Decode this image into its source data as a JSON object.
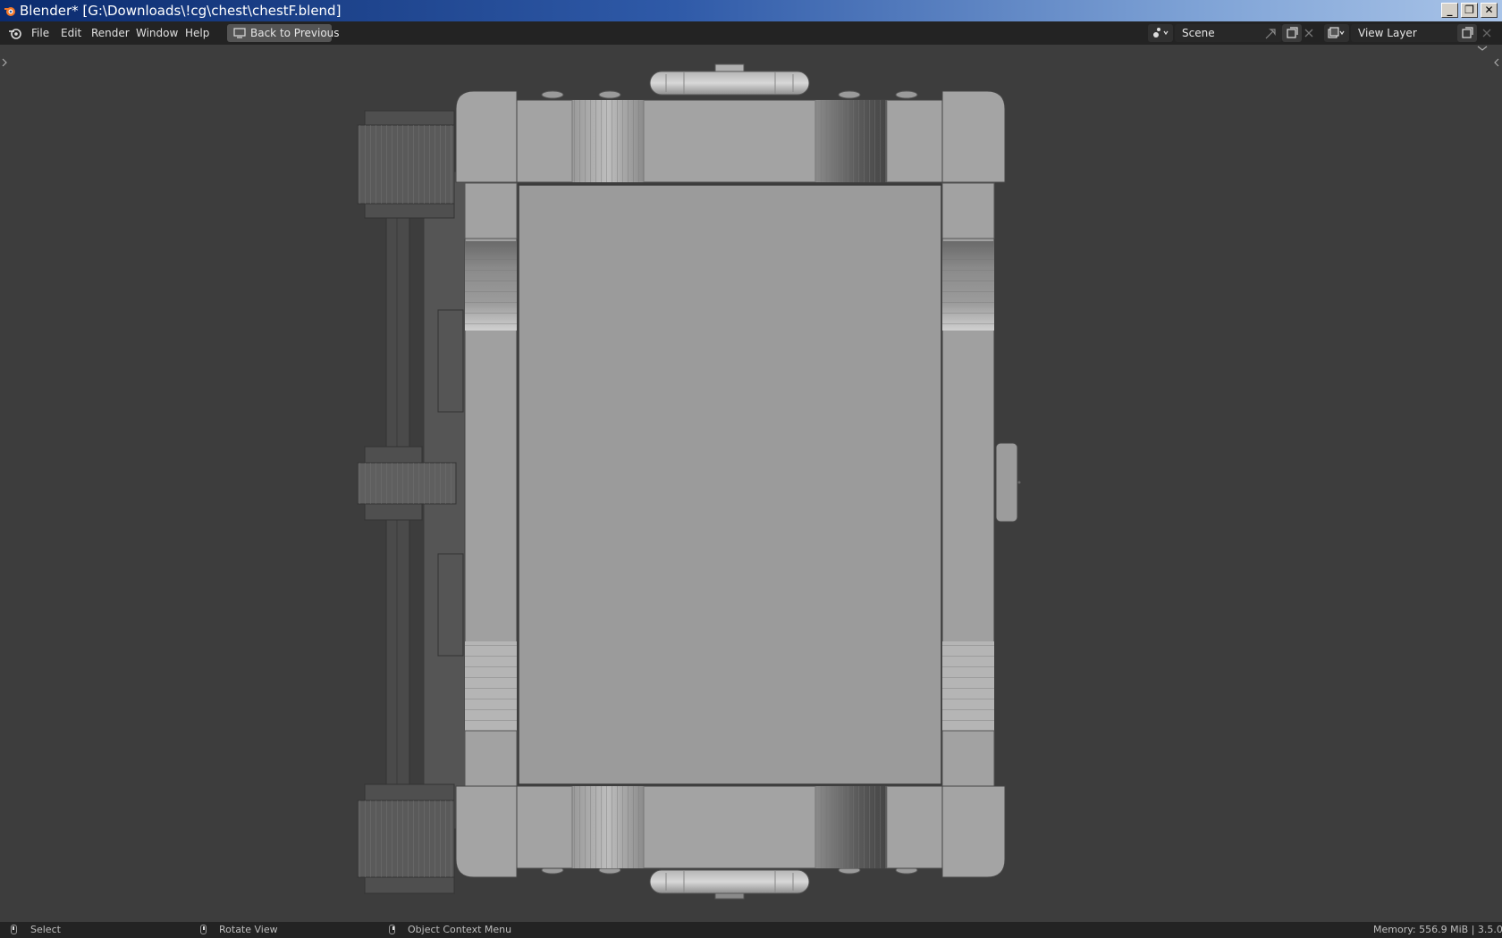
{
  "window": {
    "title": "Blender* [G:\\Downloads\\!cg\\chest\\chestF.blend]",
    "minimize": "_",
    "restore": "❐",
    "close": "✕"
  },
  "menu": {
    "items": [
      "File",
      "Edit",
      "Render",
      "Window",
      "Help"
    ],
    "back_button": "Back to Previous"
  },
  "scene": {
    "label": "Scene"
  },
  "view_layer": {
    "label": "View Layer"
  },
  "status": {
    "select": "Select",
    "rotate": "Rotate View",
    "context": "Object Context Menu",
    "memory": "Memory: 556.9 MiB | 3.5.0"
  },
  "icons": [
    "blender-logo-icon",
    "back-to-previous-icon",
    "scene-icon",
    "pin-icon",
    "new-scene-icon",
    "close-icon",
    "view-layer-icon",
    "mouse-icon"
  ]
}
